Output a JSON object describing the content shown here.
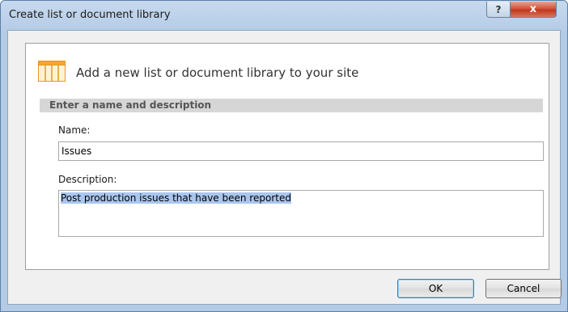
{
  "window": {
    "title": "Create list or document library",
    "help_glyph": "?",
    "close_glyph": "x"
  },
  "header": {
    "icon": "list-table-icon",
    "text": "Add a new list or document library to your site"
  },
  "section": {
    "title": "Enter a name and description"
  },
  "form": {
    "name_label": "Name:",
    "name_value": "Issues",
    "description_label": "Description:",
    "description_value": "Post production issues that have been reported"
  },
  "buttons": {
    "ok_label": "OK",
    "cancel_label": "Cancel"
  },
  "colors": {
    "selection_highlight": "#a9c6ee",
    "icon_orange": "#f0a030",
    "close_red": "#c9452c"
  }
}
